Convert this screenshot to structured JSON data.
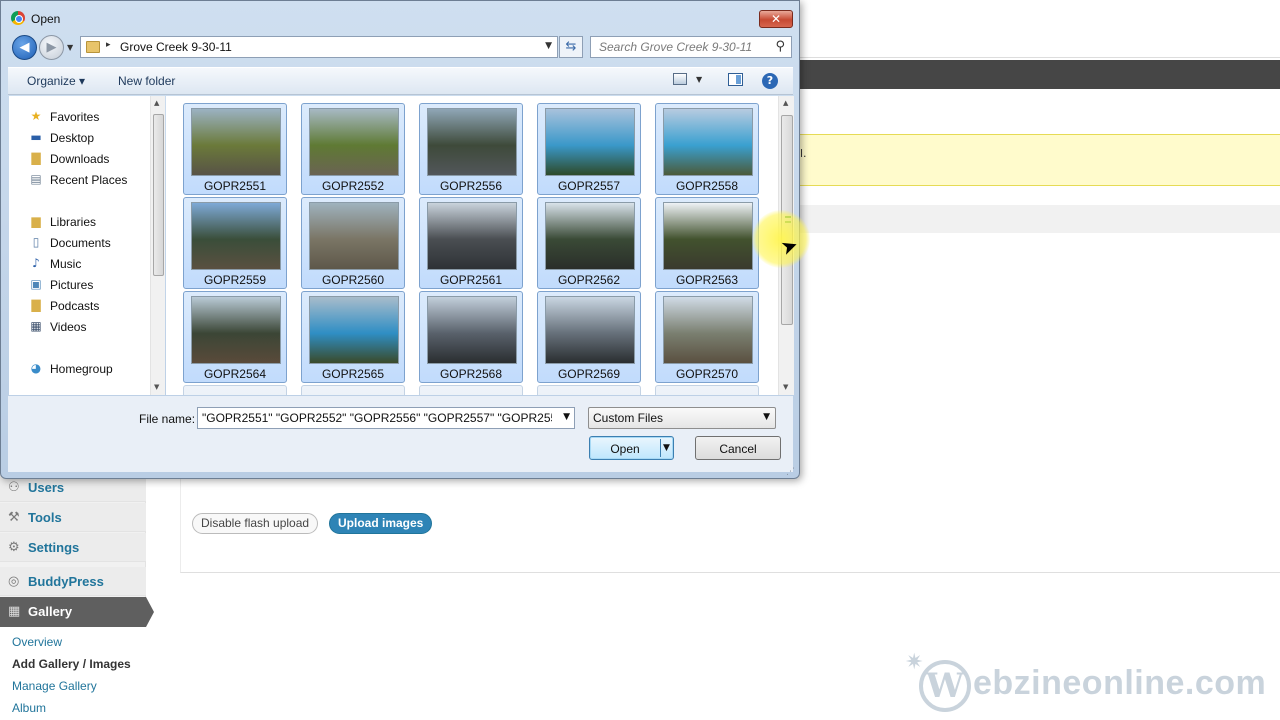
{
  "dialog": {
    "title": "Open",
    "close_symbol": "✕",
    "address": {
      "path_arrow": "▸",
      "folder": "Grove Creek 9-30-11",
      "dropdown": "▼"
    },
    "search": {
      "placeholder": "Search Grove Creek 9-30-11"
    },
    "toolbar": {
      "organize": "Organize ▾",
      "new_folder": "New folder",
      "help": "?"
    },
    "nav_pane": {
      "items": [
        {
          "label": "Favorites",
          "icon": "star-icon",
          "glyph": "★",
          "color": "#e8b020"
        },
        {
          "label": "Desktop",
          "icon": "desktop-icon",
          "glyph": "▬",
          "color": "#2b5fa8"
        },
        {
          "label": "Downloads",
          "icon": "downloads-folder-icon",
          "glyph": "▇",
          "color": "#d9b04a"
        },
        {
          "label": "Recent Places",
          "icon": "recent-places-icon",
          "glyph": "▤",
          "color": "#6e7f92"
        },
        {
          "label": "Libraries",
          "icon": "libraries-icon",
          "glyph": "▆",
          "color": "#d9b04a"
        },
        {
          "label": "Documents",
          "icon": "documents-icon",
          "glyph": "▯",
          "color": "#5d7fa8"
        },
        {
          "label": "Music",
          "icon": "music-icon",
          "glyph": "♪",
          "color": "#2b5fa8"
        },
        {
          "label": "Pictures",
          "icon": "pictures-icon",
          "glyph": "▣",
          "color": "#4d86b8"
        },
        {
          "label": "Podcasts",
          "icon": "podcasts-folder-icon",
          "glyph": "▇",
          "color": "#d9b04a"
        },
        {
          "label": "Videos",
          "icon": "videos-icon",
          "glyph": "▦",
          "color": "#3a4e6a"
        },
        {
          "label": "Homegroup",
          "icon": "homegroup-icon",
          "glyph": "◕",
          "color": "#3a8cc9"
        }
      ]
    },
    "files": [
      {
        "name": "GOPR2551",
        "colors": [
          "#9bb2c2",
          "#6b7a3a",
          "#585346"
        ]
      },
      {
        "name": "GOPR2552",
        "colors": [
          "#a7b9c4",
          "#5f7a34",
          "#6a6352"
        ]
      },
      {
        "name": "GOPR2556",
        "colors": [
          "#8fa6b6",
          "#3e4a3a",
          "#52565a"
        ]
      },
      {
        "name": "GOPR2557",
        "colors": [
          "#a8c2dc",
          "#3a98c9",
          "#2e4a2a"
        ]
      },
      {
        "name": "GOPR2558",
        "colors": [
          "#b7cbe0",
          "#3aa0d0",
          "#4b5a3a"
        ]
      },
      {
        "name": "GOPR2559",
        "colors": [
          "#7ea9d6",
          "#3a4e3a",
          "#5a5040"
        ]
      },
      {
        "name": "GOPR2560",
        "colors": [
          "#9fb2bd",
          "#7a7565",
          "#5e584a"
        ]
      },
      {
        "name": "GOPR2561",
        "colors": [
          "#c9d3dc",
          "#4a4e52",
          "#2e3236"
        ]
      },
      {
        "name": "GOPR2562",
        "colors": [
          "#d8e2ea",
          "#3a4a36",
          "#2a2e2a"
        ]
      },
      {
        "name": "GOPR2563",
        "colors": [
          "#eef2f6",
          "#42522e",
          "#3a3a2e"
        ]
      },
      {
        "name": "GOPR2564",
        "colors": [
          "#b9cad6",
          "#3b4636",
          "#5a4a3a"
        ]
      },
      {
        "name": "GOPR2565",
        "colors": [
          "#a8bccb",
          "#2f8ec4",
          "#3a4a2a"
        ]
      },
      {
        "name": "GOPR2568",
        "colors": [
          "#c2cfdb",
          "#59616b",
          "#2a2e30"
        ]
      },
      {
        "name": "GOPR2569",
        "colors": [
          "#c9d6e2",
          "#66707a",
          "#2a2e30"
        ]
      },
      {
        "name": "GOPR2570",
        "colors": [
          "#d0dbe6",
          "#7a7f70",
          "#5a5040"
        ]
      }
    ],
    "file_name_label": "File name:",
    "file_name_value": "\"GOPR2551\" \"GOPR2552\" \"GOPR2556\" \"GOPR2557\" \"GOPR2558\" \"G",
    "file_type": "Custom Files",
    "open_button": "Open",
    "cancel_button": "Cancel"
  },
  "wordpress": {
    "notice_fragment": "l.",
    "buttons": {
      "disable_flash": "Disable flash upload",
      "upload_images": "Upload images"
    },
    "menu": [
      {
        "label": "Users",
        "icon": "users-icon",
        "glyph": "👥"
      },
      {
        "label": "Tools",
        "icon": "tools-icon",
        "glyph": "⚒"
      },
      {
        "label": "Settings",
        "icon": "settings-icon",
        "glyph": "⚙"
      },
      {
        "label": "BuddyPress",
        "icon": "buddypress-icon",
        "glyph": "◎"
      }
    ],
    "gallery_menu": {
      "label": "Gallery",
      "glyph": "▦"
    },
    "gallery_submenu": [
      "Overview",
      "Add Gallery / Images",
      "Manage Gallery",
      "Album"
    ]
  },
  "watermark": {
    "logo_letter": "W",
    "text": "ebzineonline.com"
  },
  "colors": {
    "accent": "#21759b",
    "selection": "#c1dbfc",
    "notice": "#fffbcc"
  }
}
